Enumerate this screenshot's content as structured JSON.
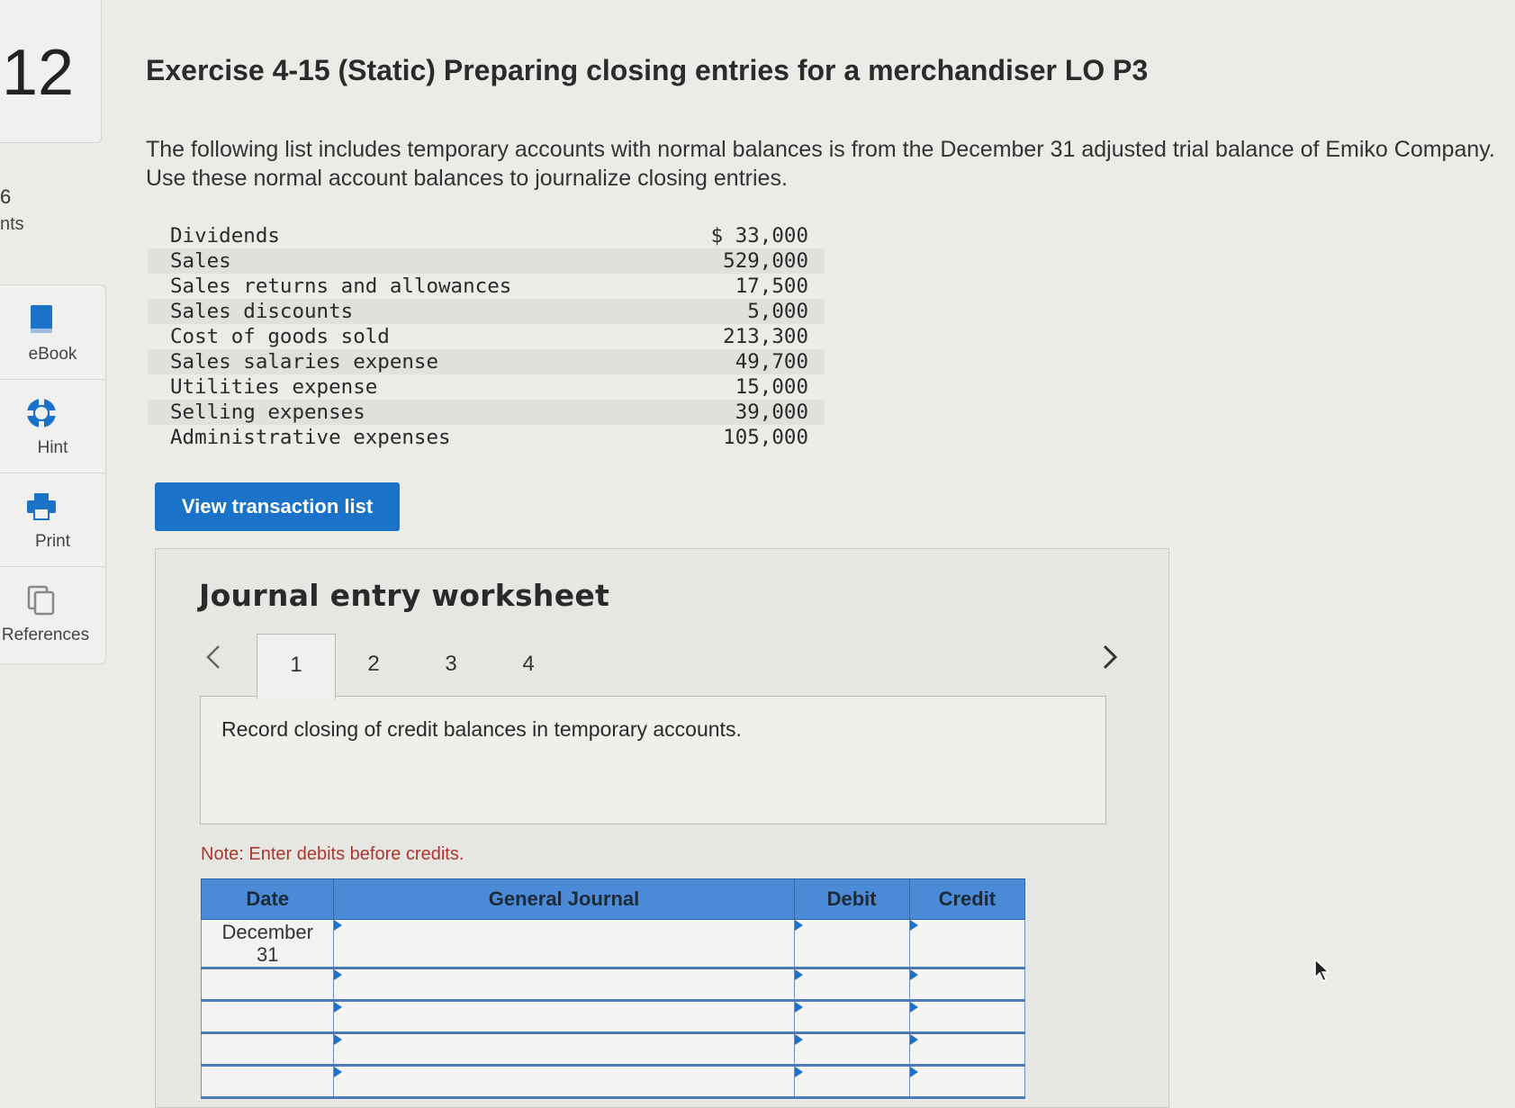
{
  "question": {
    "number": "12",
    "points_value": "6",
    "points_label": "nts"
  },
  "tools": [
    {
      "label": "eBook",
      "icon": "book-icon"
    },
    {
      "label": "Hint",
      "icon": "lifebuoy-icon"
    },
    {
      "label": "Print",
      "icon": "printer-icon"
    },
    {
      "label": "References",
      "icon": "copy-icon"
    }
  ],
  "title": "Exercise 4-15 (Static) Preparing closing entries for a merchandiser LO P3",
  "intro": "The following list includes temporary accounts with normal balances is from the December 31 adjusted trial balance of Emiko Company. Use these normal account balances to journalize closing entries.",
  "accounts": [
    {
      "name": "Dividends",
      "amount": "$ 33,000"
    },
    {
      "name": "Sales",
      "amount": "529,000"
    },
    {
      "name": "Sales returns and allowances",
      "amount": "17,500"
    },
    {
      "name": "Sales discounts",
      "amount": "5,000"
    },
    {
      "name": "Cost of goods sold",
      "amount": "213,300"
    },
    {
      "name": "Sales salaries expense",
      "amount": "49,700"
    },
    {
      "name": "Utilities expense",
      "amount": "15,000"
    },
    {
      "name": "Selling expenses",
      "amount": "39,000"
    },
    {
      "name": "Administrative expenses",
      "amount": "105,000"
    }
  ],
  "view_button": "View transaction list",
  "worksheet": {
    "title": "Journal entry worksheet",
    "prev_arrow": "<",
    "next_arrow": ">",
    "tabs": [
      "1",
      "2",
      "3",
      "4"
    ],
    "instruction": "Record closing of credit balances in temporary accounts.",
    "note": "Note: Enter debits before credits.",
    "columns": [
      "Date",
      "General Journal",
      "Debit",
      "Credit"
    ],
    "first_date_line1": "December",
    "first_date_line2": "31"
  },
  "colors": {
    "button_blue": "#1a73c8",
    "header_blue": "#4a8ad6",
    "note_red": "#b0352b"
  }
}
